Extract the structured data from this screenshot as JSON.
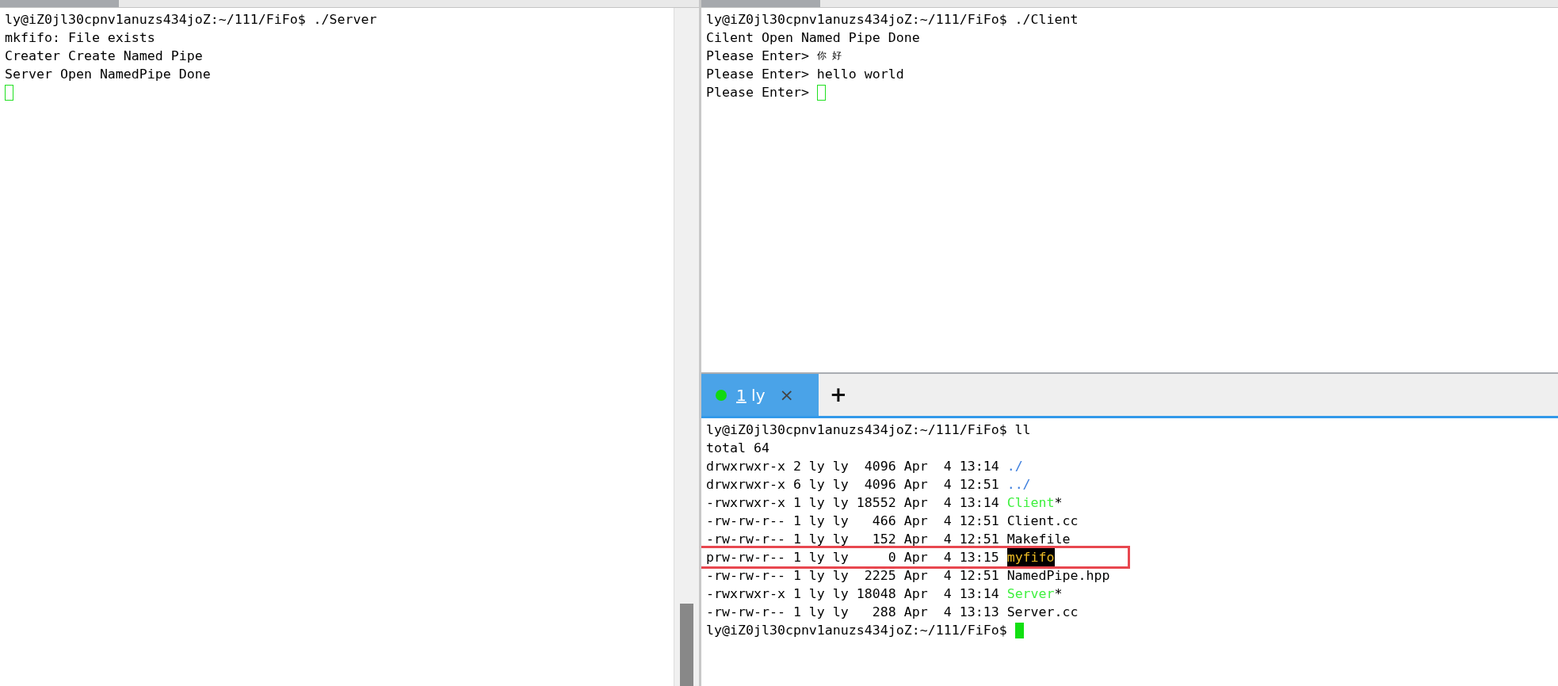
{
  "left_terminal": {
    "focused": false,
    "lines": [
      {
        "parts": [
          {
            "kind": "plain",
            "text": "ly@iZ0jl30cpnv1anuzs434joZ:~/111/FiFo$ ./Server"
          }
        ]
      },
      {
        "parts": [
          {
            "kind": "plain",
            "text": "mkfifo: File exists"
          }
        ]
      },
      {
        "parts": [
          {
            "kind": "plain",
            "text": "Creater Create Named Pipe"
          }
        ]
      },
      {
        "parts": [
          {
            "kind": "plain",
            "text": "Server Open NamedPipe Done"
          }
        ]
      }
    ]
  },
  "right_top_terminal": {
    "focused": false,
    "lines": [
      {
        "parts": [
          {
            "kind": "plain",
            "text": "ly@iZ0jl30cpnv1anuzs434joZ:~/111/FiFo$ ./Client"
          }
        ]
      },
      {
        "parts": [
          {
            "kind": "plain",
            "text": "Cilent Open Named Pipe Done"
          }
        ]
      },
      {
        "parts": [
          {
            "kind": "plain",
            "text": "Please Enter> "
          },
          {
            "kind": "cjk",
            "text": "你 好"
          }
        ]
      },
      {
        "parts": [
          {
            "kind": "plain",
            "text": "Please Enter> hello world"
          }
        ]
      },
      {
        "parts": [
          {
            "kind": "plain",
            "text": "Please Enter> "
          }
        ]
      }
    ]
  },
  "tab_bar": {
    "tabs": [
      {
        "number": "1",
        "label": "ly",
        "close": "×",
        "selected": true,
        "color": "#11d911"
      }
    ],
    "new_tab": "+"
  },
  "right_bottom_terminal": {
    "focused": true,
    "lines": [
      {
        "parts": [
          {
            "kind": "plain",
            "text": "ly@iZ0jl30cpnv1anuzs434joZ:~/111/FiFo$ ll"
          }
        ]
      },
      {
        "parts": [
          {
            "kind": "plain",
            "text": "total 64"
          }
        ]
      },
      {
        "parts": [
          {
            "kind": "plain",
            "text": "drwxrwxr-x 2 ly ly  4096 Apr  4 13:14 "
          },
          {
            "kind": "dir",
            "text": "./"
          }
        ]
      },
      {
        "parts": [
          {
            "kind": "plain",
            "text": "drwxrwxr-x 6 ly ly  4096 Apr  4 12:51 "
          },
          {
            "kind": "dir",
            "text": "../"
          }
        ]
      },
      {
        "parts": [
          {
            "kind": "plain",
            "text": "-rwxrwxr-x 1 ly ly 18552 Apr  4 13:14 "
          },
          {
            "kind": "exec",
            "text": "Client"
          },
          {
            "kind": "plain",
            "text": "*"
          }
        ]
      },
      {
        "parts": [
          {
            "kind": "plain",
            "text": "-rw-rw-r-- 1 ly ly   466 Apr  4 12:51 Client.cc"
          }
        ]
      },
      {
        "parts": [
          {
            "kind": "plain",
            "text": "-rw-rw-r-- 1 ly ly   152 Apr  4 12:51 Makefile"
          }
        ]
      },
      {
        "marked": true,
        "parts": [
          {
            "kind": "plain",
            "text": "prw-rw-r-- 1 ly ly     0 Apr  4 13:15 "
          },
          {
            "kind": "fifo",
            "text": "myfifo"
          }
        ]
      },
      {
        "parts": [
          {
            "kind": "plain",
            "text": "-rw-rw-r-- 1 ly ly  2225 Apr  4 12:51 NamedPipe.hpp"
          }
        ]
      },
      {
        "parts": [
          {
            "kind": "plain",
            "text": "-rwxrwxr-x 1 ly ly 18048 Apr  4 13:14 "
          },
          {
            "kind": "exec",
            "text": "Server"
          },
          {
            "kind": "plain",
            "text": "*"
          }
        ]
      },
      {
        "parts": [
          {
            "kind": "plain",
            "text": "-rw-rw-r-- 1 ly ly   288 Apr  4 13:13 Server.cc"
          }
        ]
      },
      {
        "parts": [
          {
            "kind": "plain",
            "text": "ly@iZ0jl30cpnv1anuzs434joZ:~/111/FiFo$ "
          }
        ]
      }
    ]
  }
}
